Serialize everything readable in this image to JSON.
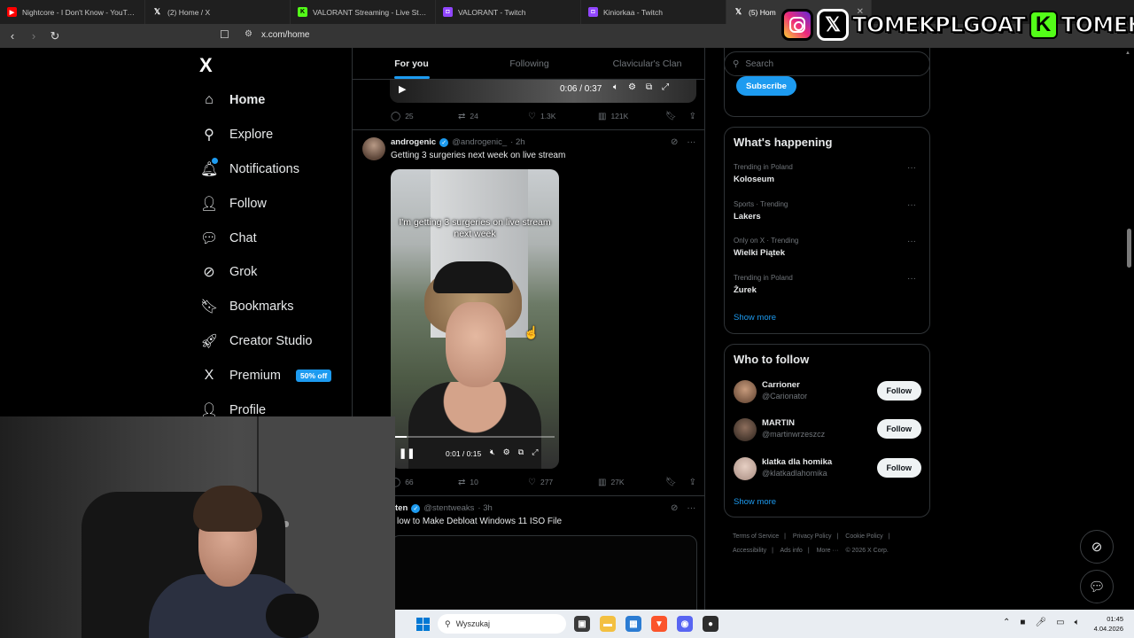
{
  "browser": {
    "tabs": [
      {
        "icon": "youtube-favicon",
        "title": "Nightcore - I Don't Know - YouTube"
      },
      {
        "icon": "x-favicon",
        "title": "(2) Home / X"
      },
      {
        "icon": "kick-favicon",
        "title": "VALORANT Streaming - Live Streams"
      },
      {
        "icon": "twitch-favicon",
        "title": "VALORANT - Twitch"
      },
      {
        "icon": "twitch-favicon",
        "title": "Kiniorkaa - Twitch"
      },
      {
        "icon": "x-favicon",
        "title": "(5) Hom",
        "active": true
      }
    ],
    "url": "x.com/home"
  },
  "stream_overlay": {
    "social_handle": "TOMEKPLGOAT",
    "kick_handle": "TOMEKPL",
    "kick_letter": "K"
  },
  "sidebar": {
    "logo": "X",
    "items": [
      {
        "label": "Home",
        "icon": "home-icon",
        "glyph": "⌂",
        "active": true
      },
      {
        "label": "Explore",
        "icon": "search-icon",
        "glyph": "⚲"
      },
      {
        "label": "Notifications",
        "icon": "bell-icon",
        "glyph": "🔔︎"
      },
      {
        "label": "Follow",
        "icon": "person-add-icon",
        "glyph": "👤︎"
      },
      {
        "label": "Chat",
        "icon": "chat-bubble-icon",
        "glyph": "💬︎"
      },
      {
        "label": "Grok",
        "icon": "grok-icon",
        "glyph": "⊘"
      },
      {
        "label": "Bookmarks",
        "icon": "bookmark-icon",
        "glyph": "🔖︎"
      },
      {
        "label": "Creator Studio",
        "icon": "rocket-icon",
        "glyph": "🚀︎"
      },
      {
        "label": "Premium",
        "icon": "x-premium-icon",
        "glyph": "X",
        "badge": "50% off"
      },
      {
        "label": "Profile",
        "icon": "profile-icon",
        "glyph": "👤︎"
      }
    ]
  },
  "feed": {
    "tabs": [
      "For you",
      "Following",
      "Clavicular's Clan"
    ],
    "video1": {
      "time": "0:06 / 0:37"
    },
    "post1_stats": {
      "replies": "25",
      "reposts": "24",
      "likes": "1.3K",
      "views": "121K"
    },
    "post2": {
      "name": "androgenic",
      "handle": "@androgenic_",
      "time": "· 2h",
      "text": "Getting 3 surgeries next week on live stream",
      "video_caption": "I'm getting 3 surgeries on live stream next week",
      "video_time": "0:01 / 0:15",
      "video_progress": 0.07,
      "stats": {
        "replies": "66",
        "reposts": "10",
        "likes": "277",
        "views": "27K"
      }
    },
    "post3": {
      "name": "ten",
      "handle": "@stentweaks",
      "time": "· 3h",
      "text": "low to Make Debloat Windows 11 ISO File"
    }
  },
  "right": {
    "search_placeholder": "Search",
    "subscribe_label": "Subscribe",
    "happening": {
      "title": "What's happening",
      "trends": [
        {
          "meta": "Trending in Poland",
          "name": "Koloseum"
        },
        {
          "meta": "Sports · Trending",
          "name": "Lakers"
        },
        {
          "meta": "Only on X · Trending",
          "name": "Wielki Piątek"
        },
        {
          "meta": "Trending in Poland",
          "name": "Żurek"
        }
      ],
      "show_more": "Show more"
    },
    "who_to_follow": {
      "title": "Who to follow",
      "accounts": [
        {
          "name": "Carrioner",
          "handle": "@Carionator",
          "button": "Follow"
        },
        {
          "name": "MARTIN",
          "handle": "@martinwrzeszcz",
          "button": "Follow"
        },
        {
          "name": "klatka dla homika",
          "handle": "@klatkadlahomika",
          "button": "Follow"
        }
      ],
      "show_more": "Show more"
    },
    "footer": {
      "links": [
        "Terms of Service",
        "|",
        "Privacy Policy",
        "|",
        "Cookie Policy",
        "|",
        "Accessibility",
        "|",
        "Ads info",
        "|",
        "More ···"
      ],
      "copyright": "© 2026 X Corp."
    }
  },
  "taskbar": {
    "search_placeholder": "Wyszukaj",
    "time": "01:45",
    "date": "4.04.2026"
  },
  "colors": {
    "accent": "#1d9bf0",
    "background": "#000000",
    "border": "#2f3336",
    "muted_text": "#71767b",
    "kick_green": "#53fc18"
  }
}
